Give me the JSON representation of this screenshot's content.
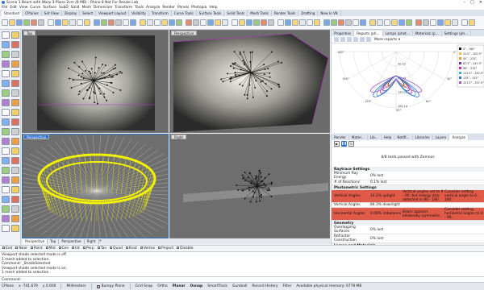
{
  "title": "Scene 1 Beam with Warp 3-Plane 2cm (8 MB) - Rhino 8 Not For Resale Lab",
  "menu": [
    "File",
    "Edit",
    "View",
    "Curve",
    "Surface",
    "SubD",
    "Solid",
    "Mesh",
    "Dimension",
    "Transform",
    "Tools",
    "Analyze",
    "Render",
    "Panels",
    "Photopia",
    "Help"
  ],
  "tabs": [
    "Standard",
    "CPlanes",
    "Set View",
    "Display",
    "Select",
    "Viewport Layout",
    "Visibility",
    "Transform",
    "Curve Tools",
    "Surface Tools",
    "Solid Tools",
    "Mesh Tools",
    "Render Tools",
    "Drafting",
    "New in V8"
  ],
  "viewports": {
    "top": "Top",
    "perspective": "Perspective",
    "perspective_active": "Perspective",
    "right": "Right"
  },
  "viewport_tabs": [
    "Perspective",
    "Top",
    "Perspective",
    "Right"
  ],
  "osnap": [
    "End",
    "Near",
    "Point",
    "Mid",
    "Cen",
    "Int",
    "Perp",
    "Tan",
    "Quad",
    "Knot",
    "Vertex",
    "Project",
    "Disable"
  ],
  "cmd_log": [
    "Viewport shade selected mode is off.",
    "1 mesh added to selection.",
    "Command: _ShadeSelected",
    "Viewport shade selected mode is on.",
    "1 mesh added to selection."
  ],
  "cmd_prompt": "Command:",
  "status": {
    "cplane": "CPlane",
    "x": "x -741.679",
    "y": "y 0.000",
    "units": "Millimeters",
    "layer": "Bumpy Plane",
    "grid_snap": "Grid Snap",
    "ortho": "Ortho",
    "planar": "Planar",
    "osnap": "Osnap",
    "smarttrack": "SmartTrack",
    "gumball": "Gumball",
    "record": "Record History",
    "filter": "Filter",
    "memory": "Available physical memory: 6778 MB"
  },
  "right_top_tabs": [
    "Properties",
    "Reports (ph...",
    "Lamps (phot...",
    "Materials (p...",
    "Settings (ph..."
  ],
  "more_reports": "More reports",
  "polar": {
    "angles": [
      "180°",
      "150°",
      "120°",
      "90°",
      "60°",
      "30°",
      "0°"
    ],
    "rings": [
      "40 cd",
      "80 cd",
      "120 cd",
      "160 cd"
    ],
    "cd_top": "160 cd",
    "legend": [
      "0° - 180°",
      "22.5° - 202.5°",
      "45° - 225°",
      "67.5° - 247.5°",
      "90° - 270°",
      "112.5° - 292.5°",
      "135° - 315°",
      "157.5° - 337.5°"
    ]
  },
  "legend_colors": [
    "#1a1a1a",
    "#e8c23a",
    "#f39a2e",
    "#7a2fa0",
    "#d21fb0",
    "#2bb9c9",
    "#3270d0",
    "#a055d0"
  ],
  "right_bottom_tabs": [
    "Render",
    "Mater...",
    "Lib...",
    "Help",
    "Notifi...",
    "Libraries",
    "Layers",
    "Analyze"
  ],
  "tests_passed": "6/8 tests passed with Zemnos",
  "tests": {
    "raytrace_header": "Raytrace Settings",
    "min_ray": [
      "Minimum Ray Energy",
      "0% lost"
    ],
    "reflections": [
      "# of Reactions",
      "0.1% lost"
    ],
    "photometric_header": "Photometric Settings",
    "vertical_angles": [
      "Vertical Angles",
      "14.2% uplight",
      "Vertical angles set to 0 - 90, but energy also detected in 90 - 180.",
      "Consider setting vertical angle to 0 - 180."
    ],
    "vertical_angles2": [
      "Vertical Angles",
      "84.3% downlight"
    ],
    "horizontal_angles": [
      "Horizontal Angles",
      "0.09% imbalance",
      "Beam appears bilaterally symmetric.",
      "Consider setting horizontal angles to 0 - 90."
    ],
    "geometry_header": "Geometry",
    "overlap": [
      "Overlapping Surfaces",
      "0% lost"
    ],
    "refractor": [
      "Refractor Construction",
      "0% lost"
    ],
    "lamps_header": "Lamps and Materials",
    "spectral": [
      "Spectral Material",
      "0% lost"
    ]
  }
}
